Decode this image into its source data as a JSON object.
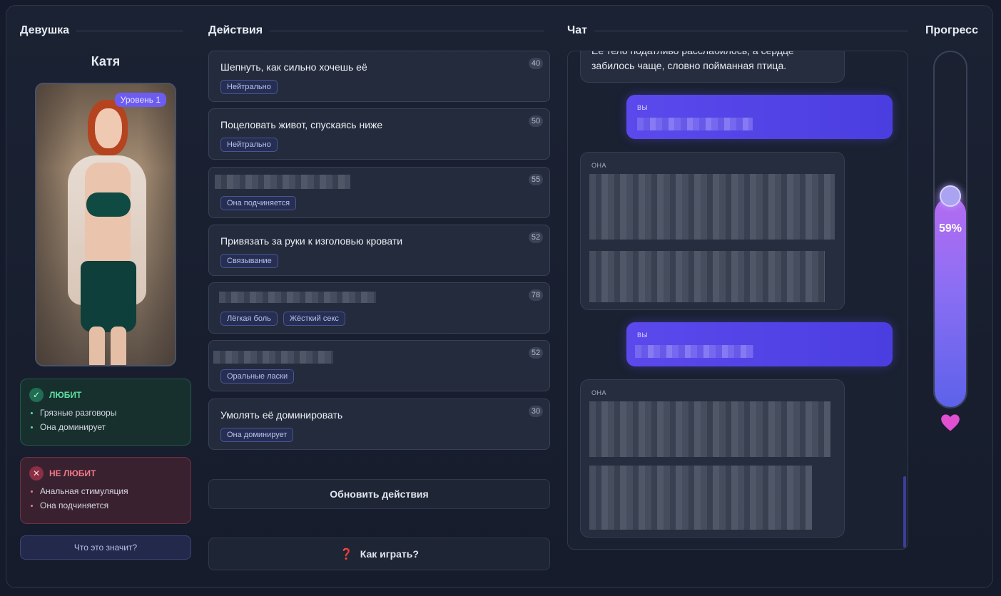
{
  "sections": {
    "girl": "Девушка",
    "actions": "Действия",
    "chat": "Чат",
    "progress": "Прогресс"
  },
  "girl": {
    "name": "Катя",
    "level": "Уровень 1",
    "likes_title": "ЛЮБИТ",
    "likes": [
      "Грязные разговоры",
      "Она доминирует"
    ],
    "dislikes_title": "НЕ ЛЮБИТ",
    "dislikes": [
      "Анальная стимуляция",
      "Она подчиняется"
    ],
    "what_button": "Что это значит?"
  },
  "actions": [
    {
      "text": "Шепнуть, как сильно хочешь её",
      "num": "40",
      "tags": [
        "Нейтрально"
      ]
    },
    {
      "text": "Поцеловать живот, спускаясь ниже",
      "num": "50",
      "tags": [
        "Нейтрально"
      ]
    },
    {
      "text": "",
      "num": "55",
      "tags": [
        "Она подчиняется"
      ]
    },
    {
      "text": "Привязать за руки к изголовью кровати",
      "num": "52",
      "tags": [
        "Связывание"
      ]
    },
    {
      "text": "",
      "num": "78",
      "tags": [
        "Лёгкая боль",
        "Жёсткий секс"
      ]
    },
    {
      "text": "",
      "num": "52",
      "tags": [
        "Оральные ласки"
      ]
    },
    {
      "text": "Умолять её доминировать",
      "num": "30",
      "tags": [
        "Она доминирует"
      ]
    }
  ],
  "refresh_button": "Обновить действия",
  "how_button": "Как играть?",
  "how_icon": "❓",
  "chat": {
    "first_message": "Её тело податливо расслабилось, а сердце забилось чаще, словно пойманная птица.",
    "me_label": "ВЫ",
    "she_label": "ОНА"
  },
  "progress": {
    "percent_label": "59%",
    "value": 0.59
  },
  "colors": {
    "accent": "#5b49ec",
    "like": "#5fe0a2",
    "dislike": "#f07a8a",
    "heart": "#e050d0"
  }
}
